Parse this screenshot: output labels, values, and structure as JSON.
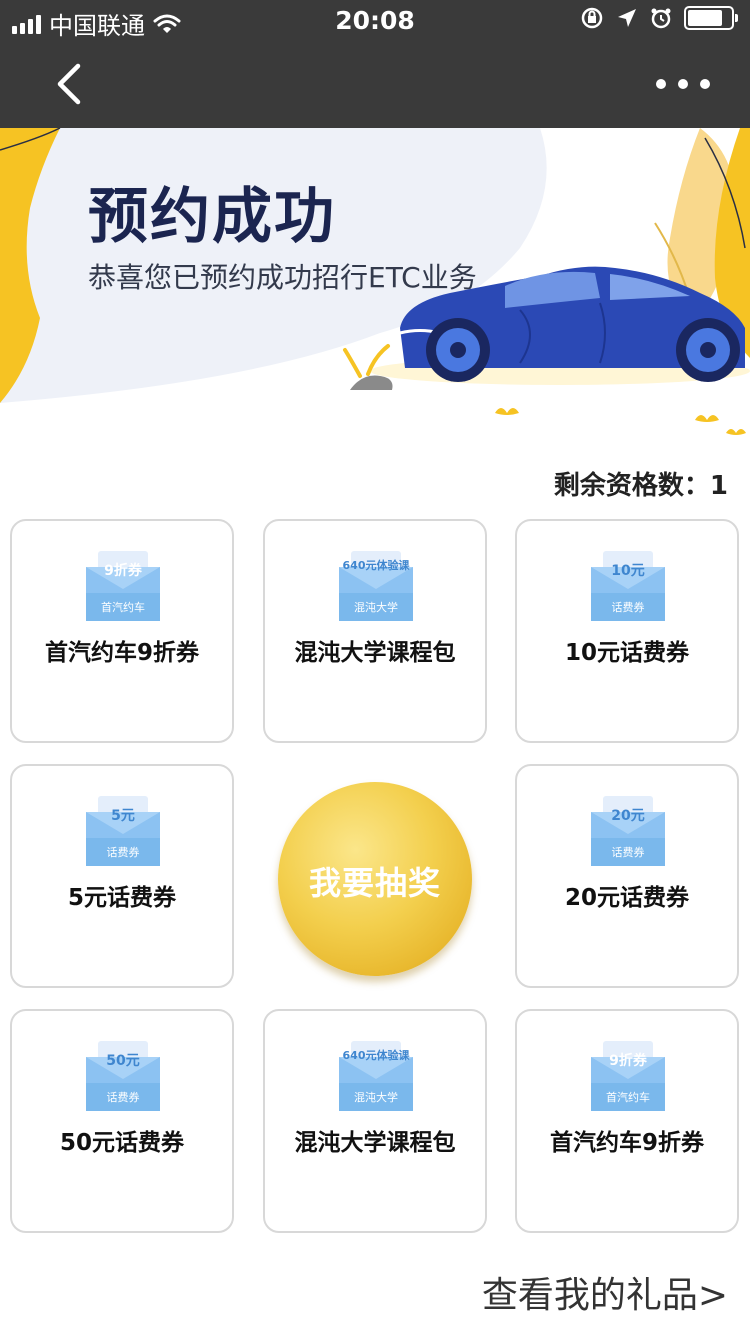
{
  "status_bar": {
    "carrier": "中国联通",
    "time": "20:08"
  },
  "banner": {
    "title": "预约成功",
    "subtitle": "恭喜您已预约成功招行ETC业务"
  },
  "remaining": "剩余资格数：1",
  "prizes": [
    {
      "label": "首汽约车9折券",
      "coupon_main": "9折券",
      "coupon_sub": "首汽约车"
    },
    {
      "label": "混沌大学课程包",
      "coupon_main": "640元体验课",
      "coupon_sub": "混沌大学"
    },
    {
      "label": "10元话费券",
      "coupon_main": "10元",
      "coupon_sub": "话费券"
    },
    {
      "label": "5元话费券",
      "coupon_main": "5元",
      "coupon_sub": "话费券"
    },
    {
      "label": "20元话费券",
      "coupon_main": "20元",
      "coupon_sub": "话费券"
    },
    {
      "label": "50元话费券",
      "coupon_main": "50元",
      "coupon_sub": "话费券"
    },
    {
      "label": "混沌大学课程包",
      "coupon_main": "640元体验课",
      "coupon_sub": "混沌大学"
    },
    {
      "label": "首汽约车9折券",
      "coupon_main": "9折券",
      "coupon_sub": "首汽约车"
    }
  ],
  "draw_button": "我要抽奖",
  "gift_link": "查看我的礼品>",
  "colors": {
    "nav_bg": "#3a3a3a",
    "title_navy": "#1b2550",
    "accent_yellow": "#f5c12a",
    "coupon_blue": "#7ab8ec"
  }
}
